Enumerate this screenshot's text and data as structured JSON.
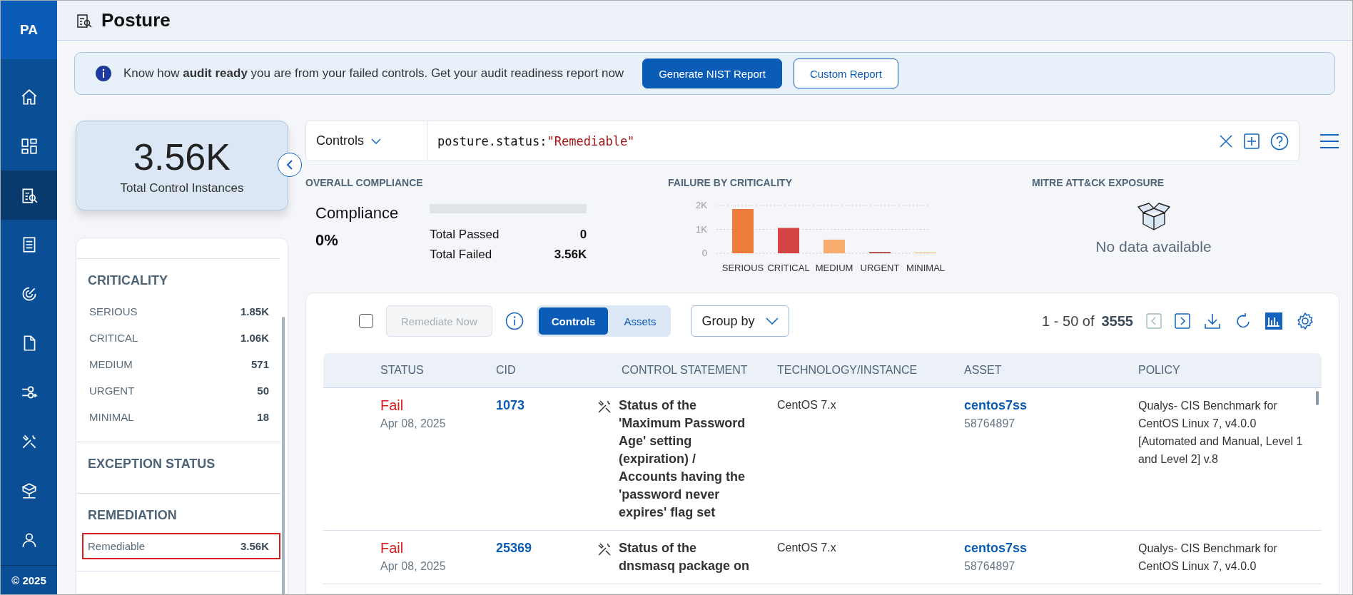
{
  "sidebar": {
    "logo": "PA",
    "items": [
      {
        "selected": false
      },
      {
        "selected": false
      },
      {
        "selected": true
      },
      {
        "selected": false
      },
      {
        "selected": false
      },
      {
        "selected": false
      },
      {
        "selected": false
      },
      {
        "selected": false
      },
      {
        "selected": false
      },
      {
        "selected": false
      }
    ],
    "copyright": "© 2025"
  },
  "header": {
    "title": "Posture"
  },
  "banner": {
    "text": "Know how **audit ready** you are from your failed controls. Get your audit readiness report now",
    "buttons": [
      {
        "label": "Generate NIST Report",
        "kind": "primary"
      },
      {
        "label": "Custom Report",
        "kind": "secondary"
      }
    ]
  },
  "summary": {
    "value": "3.56K",
    "label": "Total Control Instances"
  },
  "filters": [
    {
      "title": "CRITICALITY",
      "items": [
        {
          "label": "SERIOUS",
          "count": "1.85K",
          "selected": false
        },
        {
          "label": "CRITICAL",
          "count": "1.06K",
          "selected": false
        },
        {
          "label": "MEDIUM",
          "count": "571",
          "selected": false
        },
        {
          "label": "URGENT",
          "count": "50",
          "selected": false
        },
        {
          "label": "MINIMAL",
          "count": "18",
          "selected": false
        }
      ]
    },
    {
      "title": "EXCEPTION STATUS"
    },
    {
      "title": "REMEDIATION",
      "items": [
        {
          "label": "Remediable",
          "count": "3.56K",
          "selected": true
        }
      ]
    }
  ],
  "search": {
    "scope": "Controls",
    "query_key": "posture.status:",
    "query_value": "\"Remediable\""
  },
  "compliance": {
    "title": "OVERALL COMPLIANCE",
    "label": "Compliance",
    "value": "0%",
    "level": 0,
    "passed_label": "Total Passed",
    "passed": "0",
    "failed_label": "Total Failed",
    "failed": "3.56K"
  },
  "criticality_chart": {
    "title": "FAILURE BY CRITICALITY",
    "chart_data": {
      "type": "bar",
      "categories": [
        "SERIOUS",
        "CRITICAL",
        "MEDIUM",
        "URGENT",
        "MINIMAL"
      ],
      "values": [
        1850,
        1060,
        570,
        50,
        20
      ],
      "colors": [
        "#ed7d3a",
        "#d64545",
        "#f9ad6c",
        "#a83232",
        "#d9a520"
      ],
      "ylim": [
        0,
        2000
      ],
      "yticks": [
        {
          "value": 0,
          "label": "0"
        },
        {
          "value": 1000,
          "label": "1K"
        },
        {
          "value": 2000,
          "label": "2K"
        }
      ]
    }
  },
  "mitre": {
    "title": "MITRE ATT&CK EXPOSURE",
    "empty": "No data available"
  },
  "toolbar": {
    "remediate": "Remediate Now",
    "remediate_disabled": true,
    "tabs": [
      {
        "label": "Controls",
        "selected": true
      },
      {
        "label": "Assets",
        "selected": false
      }
    ],
    "group_by": "Group by",
    "range": "1 - 50 of",
    "total": "3555"
  },
  "table": {
    "select_all": false,
    "columns": [
      "STATUS",
      "CID",
      "CONTROL STATEMENT",
      "TECHNOLOGY/INSTANCE",
      "ASSET",
      "POLICY"
    ],
    "rows": [
      {
        "status": "Fail",
        "date": "Apr 08, 2025",
        "cid": "1073",
        "statement": "Status of the 'Maximum Password Age' setting (expiration) / Accounts having the 'password never expires' flag set",
        "technology": "CentOS 7.x",
        "asset": "centos7ss",
        "asset_id": "58764897",
        "policy": "Qualys- CIS Benchmark for CentOS Linux 7, v4.0.0 [Automated and Manual, Level 1 and Level 2] v.8"
      },
      {
        "status": "Fail",
        "date": "Apr 08, 2025",
        "cid": "25369",
        "statement": "Status of the dnsmasq package on",
        "technology": "CentOS 7.x",
        "asset": "centos7ss",
        "asset_id": "58764897",
        "policy": "Qualys- CIS Benchmark for CentOS Linux 7, v4.0.0"
      }
    ]
  }
}
